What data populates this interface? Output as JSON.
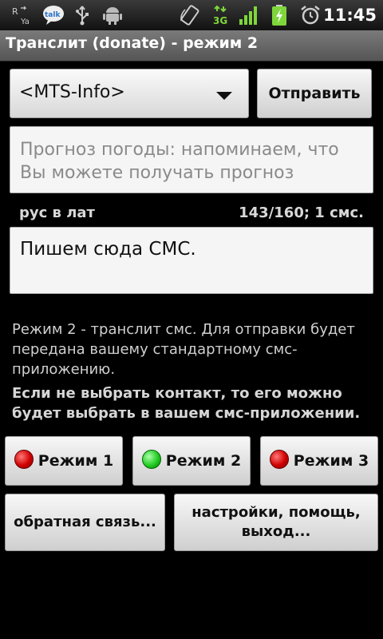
{
  "status_bar": {
    "time": "11:45",
    "icons": [
      "translit-icon",
      "talk-icon",
      "usb-icon",
      "android-debug-icon",
      "rotate-icon",
      "3g-icon",
      "signal-icon",
      "battery-charging-icon",
      "alarm-icon"
    ],
    "talk_label": "talk",
    "network_label": "3G"
  },
  "title_bar": {
    "title": "Транслит (donate) - режим 2"
  },
  "recipient": {
    "selected": "<MTS-Info>"
  },
  "send_button": {
    "label": "Отправить"
  },
  "template_field": {
    "text": "Прогноз погоды: напоминаем, что Вы можете получать прогноз"
  },
  "labels": {
    "mode": "рус в лат",
    "counter": "143/160; 1 смс."
  },
  "sms_field": {
    "text": "Пишем сюда СМС."
  },
  "info": {
    "description": "Режим 2 - транслит смс. Для отправки будет передана вашему стандартному смс-приложению.",
    "hint": "Если не выбрать контакт, то его можно будет выбрать в вашем смс-приложении."
  },
  "mode_buttons": [
    {
      "label": "Режим 1",
      "state": "inactive",
      "color": "#d00000"
    },
    {
      "label": "Режим 2",
      "state": "active",
      "color": "#22cc22"
    },
    {
      "label": "Режим 3",
      "state": "inactive",
      "color": "#d00000"
    }
  ],
  "feedback_button": {
    "label": "обратная связь..."
  },
  "settings_button": {
    "label": "настройки, помощь, выход..."
  }
}
